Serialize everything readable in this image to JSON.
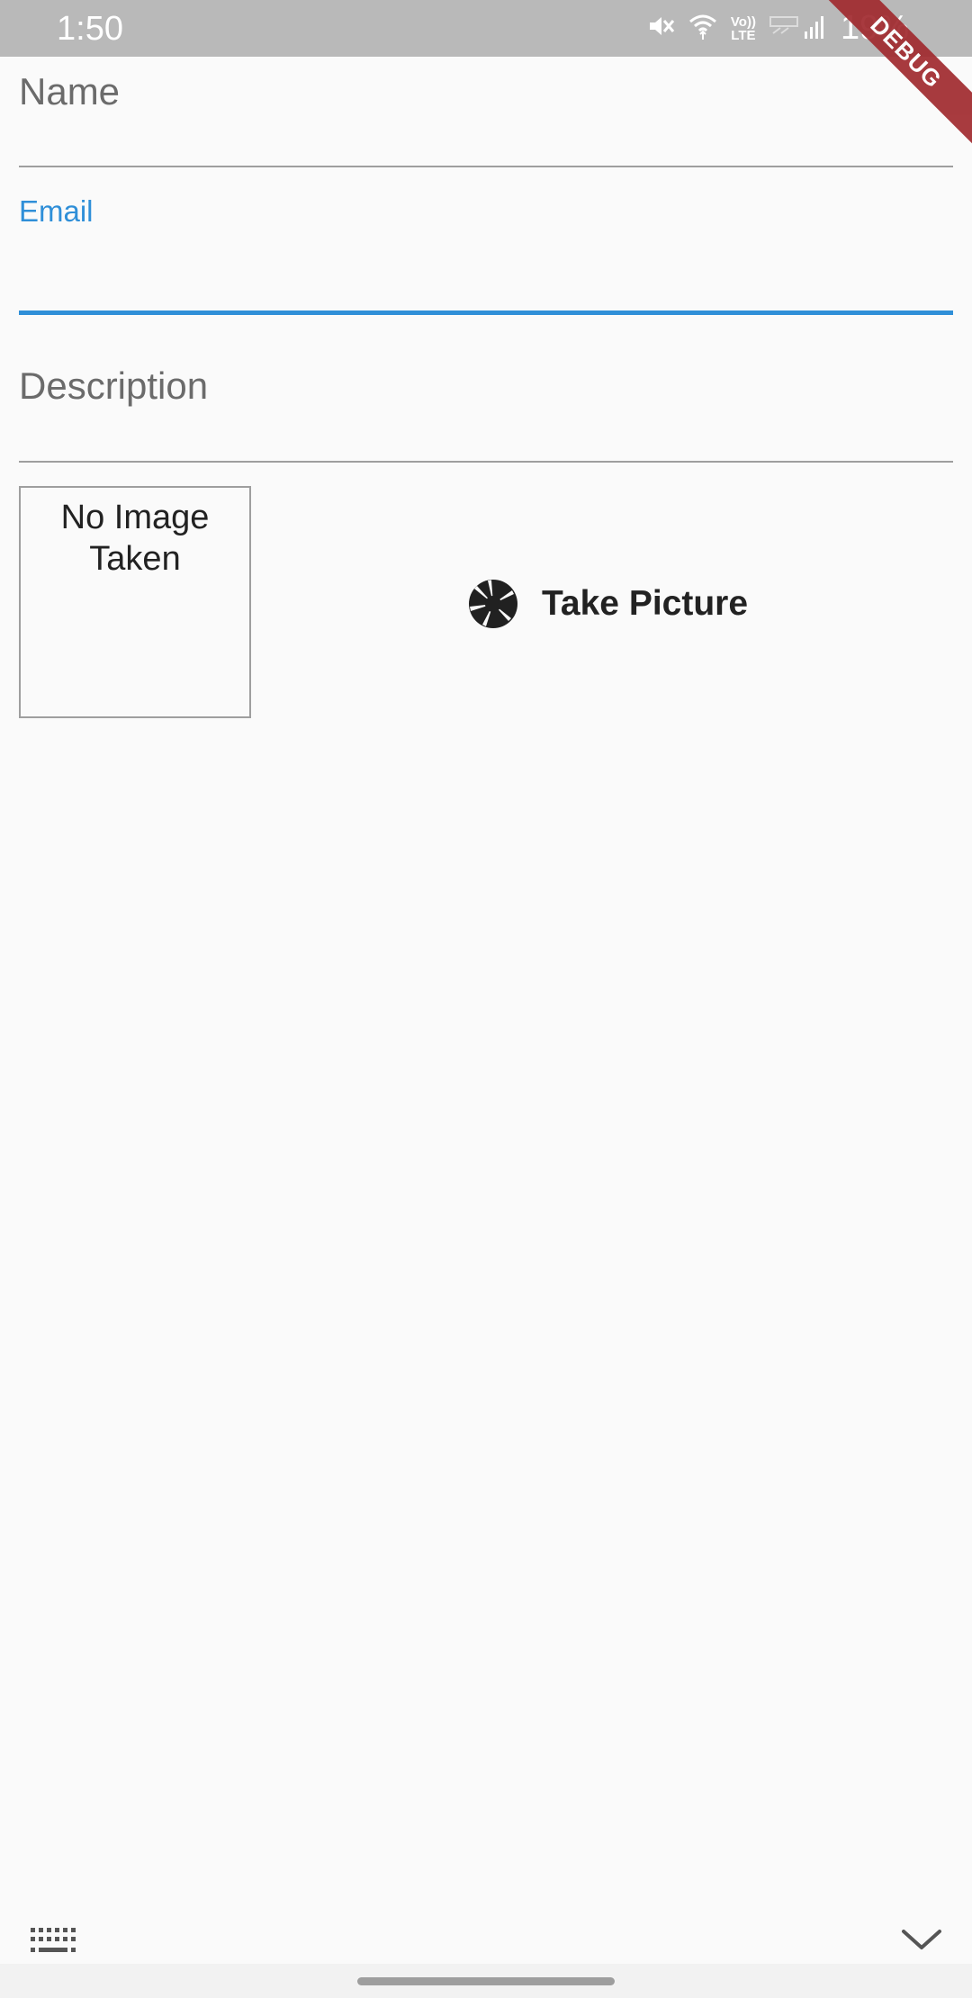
{
  "status_bar": {
    "time": "1:50",
    "battery_text": "19%",
    "icons": [
      "mute-icon",
      "wifi-icon",
      "volte-icon",
      "signal-icon",
      "battery-icon"
    ],
    "volte_top": "Vo))",
    "volte_bottom": "LTE"
  },
  "debug_banner": {
    "label": "DEBUG",
    "color": "#a12a2f"
  },
  "form": {
    "name": {
      "label": "Name",
      "value": ""
    },
    "email": {
      "label": "Email",
      "value": "",
      "accent_color": "#2f8fd8"
    },
    "description": {
      "label": "Description",
      "value": ""
    }
  },
  "image_preview": {
    "text": "No Image Taken"
  },
  "take_picture": {
    "label": "Take Picture",
    "icon": "camera-shutter-icon"
  },
  "keyboard_toolbar": {
    "left_icon": "keyboard-icon",
    "right_icon": "chevron-down-icon"
  }
}
